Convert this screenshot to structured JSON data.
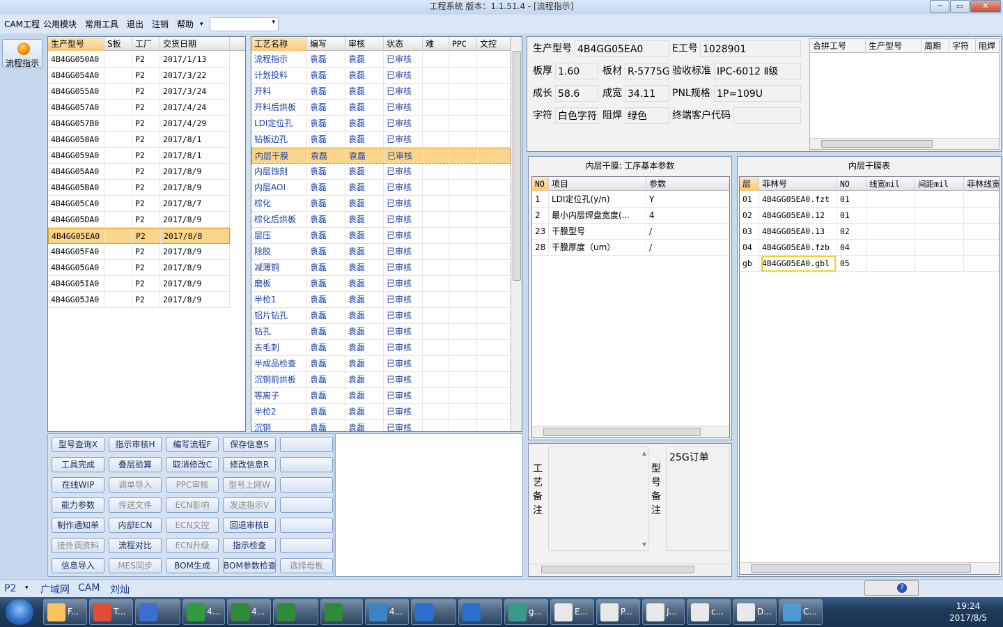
{
  "window": {
    "title": "工程系统    版本：1.1.51.4 - [流程指示]",
    "min": "─",
    "max": "▭",
    "close": "✕"
  },
  "menu": [
    "CAM工程",
    "公用模块",
    "常用工具",
    "退出",
    "注销",
    "帮助"
  ],
  "menu_dropdown": "▾",
  "left": {
    "flow_button": "流程指示"
  },
  "models": {
    "headers": [
      "生产型号",
      "S板",
      "工厂",
      "交货日期"
    ],
    "rows": [
      [
        "4B4GG050A0",
        "",
        "P2",
        "2017/1/13"
      ],
      [
        "4B4GG054A0",
        "",
        "P2",
        "2017/3/22"
      ],
      [
        "4B4GG055A0",
        "",
        "P2",
        "2017/3/24"
      ],
      [
        "4B4GG057A0",
        "",
        "P2",
        "2017/4/24"
      ],
      [
        "4B4GG057B0",
        "",
        "P2",
        "2017/4/29"
      ],
      [
        "4B4GG058A0",
        "",
        "P2",
        "2017/8/1"
      ],
      [
        "4B4GG059A0",
        "",
        "P2",
        "2017/8/1"
      ],
      [
        "4B4GG05AA0",
        "",
        "P2",
        "2017/8/9"
      ],
      [
        "4B4GG05BA0",
        "",
        "P2",
        "2017/8/9"
      ],
      [
        "4B4GG05CA0",
        "",
        "P2",
        "2017/8/7"
      ],
      [
        "4B4GG05DA0",
        "",
        "P2",
        "2017/8/9"
      ],
      [
        "4B4GG05EA0",
        "",
        "P2",
        "2017/8/8"
      ],
      [
        "4B4GG05FA0",
        "",
        "P2",
        "2017/8/9"
      ],
      [
        "4B4GG05GA0",
        "",
        "P2",
        "2017/8/9"
      ],
      [
        "4B4GG05IA0",
        "",
        "P2",
        "2017/8/9"
      ],
      [
        "4B4GG05JA0",
        "",
        "P2",
        "2017/8/9"
      ]
    ],
    "selected": 11
  },
  "process": {
    "headers": [
      "工艺名称",
      "编写",
      "审核",
      "状态",
      "难",
      "PPC",
      "文控"
    ],
    "rows": [
      [
        "流程指示",
        "袁磊",
        "袁磊",
        "已审核"
      ],
      [
        "计划投料",
        "袁磊",
        "袁磊",
        "已审核"
      ],
      [
        "开料",
        "袁磊",
        "袁磊",
        "已审核"
      ],
      [
        "开料后烘板",
        "袁磊",
        "袁磊",
        "已审核"
      ],
      [
        "LDI定位孔",
        "袁磊",
        "袁磊",
        "已审核"
      ],
      [
        "钻板边孔",
        "袁磊",
        "袁磊",
        "已审核"
      ],
      [
        "内层干膜",
        "袁磊",
        "袁磊",
        "已审核"
      ],
      [
        "内层蚀刻",
        "袁磊",
        "袁磊",
        "已审核"
      ],
      [
        "内层AOI",
        "袁磊",
        "袁磊",
        "已审核"
      ],
      [
        "棕化",
        "袁磊",
        "袁磊",
        "已审核"
      ],
      [
        "棕化后烘板",
        "袁磊",
        "袁磊",
        "已审核"
      ],
      [
        "层压",
        "袁磊",
        "袁磊",
        "已审核"
      ],
      [
        "除胶",
        "袁磊",
        "袁磊",
        "已审核"
      ],
      [
        "减薄铜",
        "袁磊",
        "袁磊",
        "已审核"
      ],
      [
        "磨板",
        "袁磊",
        "袁磊",
        "已审核"
      ],
      [
        "半检1",
        "袁磊",
        "袁磊",
        "已审核"
      ],
      [
        "铝片钻孔",
        "袁磊",
        "袁磊",
        "已审核"
      ],
      [
        "钻孔",
        "袁磊",
        "袁磊",
        "已审核"
      ],
      [
        "去毛刺",
        "袁磊",
        "袁磊",
        "已审核"
      ],
      [
        "半成品检查",
        "袁磊",
        "袁磊",
        "已审核"
      ],
      [
        "沉铜前烘板",
        "袁磊",
        "袁磊",
        "已审核"
      ],
      [
        "等离子",
        "袁磊",
        "袁磊",
        "已审核"
      ],
      [
        "半检2",
        "袁磊",
        "袁磊",
        "已审核"
      ],
      [
        "沉铜",
        "袁磊",
        "袁磊",
        "已审核"
      ]
    ],
    "selected": 6
  },
  "info": {
    "model_label": "生产型号",
    "model_value": "4B4GG05EA0",
    "eno_label": "E工号",
    "eno_value": "1028901",
    "thick_label": "板厚",
    "thick_value": "1.60",
    "material_label": "板材",
    "material_value": "R-5775G",
    "accept_label": "验收标准",
    "accept_value": "IPC-6012 Ⅱ级",
    "len_label": "成长",
    "len_value": "58.6",
    "wid_label": "成宽",
    "wid_value": "34.11",
    "pnl_label": "PNL规格",
    "pnl_value": "1P=109U",
    "char_label": "字符",
    "char_value": "白色字符",
    "mask_label": "阻焊",
    "mask_value": "绿色",
    "cust_label": "终端客户代码",
    "cust_value": ""
  },
  "merge": {
    "headers": [
      "合拼工号",
      "生产型号",
      "周期",
      "字符",
      "阻焊"
    ]
  },
  "params": {
    "title": "内层干膜: 工序基本参数",
    "headers": [
      "NO",
      "项目",
      "参数"
    ],
    "rows": [
      [
        "1",
        "LDI定位孔(y/n)",
        "Y"
      ],
      [
        "2",
        "最小内层焊盘宽度(...",
        "4"
      ],
      [
        "23",
        "干膜型号",
        "/"
      ],
      [
        "28",
        "干膜厚度（um）",
        "/"
      ]
    ]
  },
  "film": {
    "title": "内层干膜表",
    "headers": [
      "层",
      "菲林号",
      "NO",
      "线宽mil",
      "间距mil",
      "菲林线宽"
    ],
    "rows": [
      [
        "01",
        "4B4GG05EA0.fzt",
        "01"
      ],
      [
        "02",
        "4B4GG05EA0.12",
        "01"
      ],
      [
        "03",
        "4B4GG05EA0.13",
        "02"
      ],
      [
        "04",
        "4B4GG05EA0.fzb",
        "04"
      ],
      [
        "gb",
        "4B4GG05EA0.gbl",
        "05"
      ]
    ]
  },
  "buttons": [
    [
      "型号查询X",
      "指示审核H",
      "编写流程F",
      "保存信息S",
      ""
    ],
    [
      "工具完成",
      "叠层验算",
      "取消修改C",
      "修改信息R",
      ""
    ],
    [
      "在线WIP",
      "调单导入",
      "PPC审核",
      "型号上网W",
      ""
    ],
    [
      "能力参数",
      "传送文件",
      "ECN影响",
      "发送指示V",
      ""
    ],
    [
      "制作通知单",
      "内部ECN",
      "ECN文控",
      "回退审核B",
      ""
    ],
    [
      "接外调资料",
      "流程对比",
      "ECN升级",
      "指示检查",
      ""
    ],
    [
      "信息导入",
      "MES同步",
      "BOM生成",
      "BOM参数检查",
      "选择母板"
    ]
  ],
  "buttons_disabled": [
    [],
    [],
    [
      1,
      2,
      3
    ],
    [
      1,
      2,
      3
    ],
    [
      2
    ],
    [
      0,
      2
    ],
    [
      1,
      4
    ]
  ],
  "remarks": {
    "proc_label": "工艺备注",
    "model_label": "型号备注",
    "model_text": "25G订单"
  },
  "status": {
    "p2": "P2",
    "items": [
      "广域网",
      "CAM",
      "刘灿"
    ]
  },
  "taskbar": {
    "clock_time": "19:24",
    "clock_date": "2017/8/5",
    "items": [
      "F...",
      "T...",
      "",
      "4...",
      "4...",
      "",
      "",
      "4...",
      "",
      "",
      "g...",
      "E...",
      "P...",
      "J...",
      "c...",
      "D...",
      "C..."
    ]
  }
}
